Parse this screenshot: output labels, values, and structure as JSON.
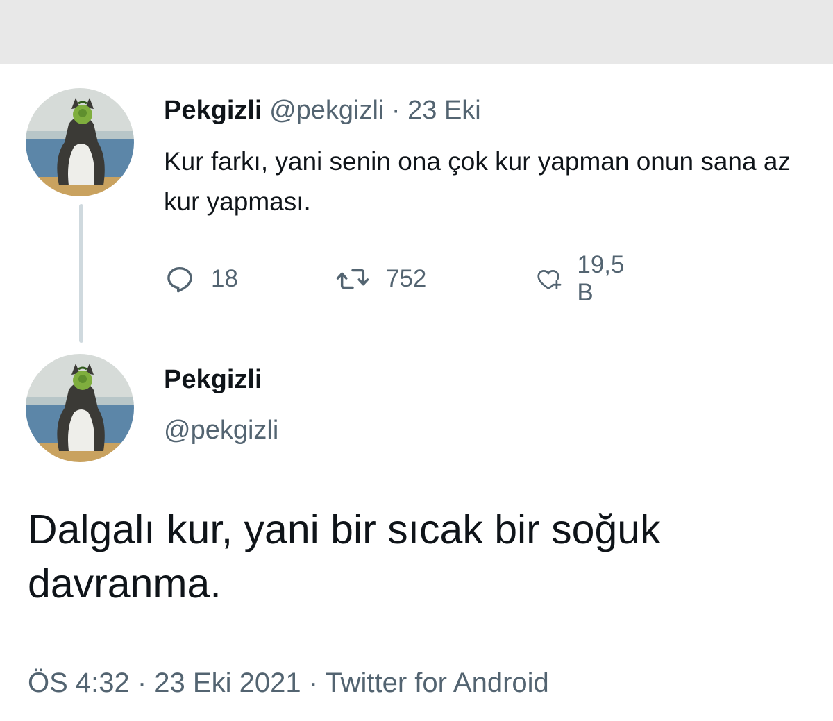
{
  "colors": {
    "text": "#0f1419",
    "secondary": "#536471",
    "thread_line": "#cfd9de",
    "top_bar": "#e8e8e8"
  },
  "tweet1": {
    "display_name": "Pekgizli",
    "meta": "@pekgizli · 23 Eki",
    "text": "Kur farkı, yani senin ona çok kur yapman onun sana az kur yapması.",
    "actions": {
      "reply": {
        "icon": "reply-icon",
        "count": "18"
      },
      "retweet": {
        "icon": "retweet-icon",
        "count": "752"
      },
      "like": {
        "icon": "heart-plus-icon",
        "count": "19,5 B"
      }
    }
  },
  "tweet2": {
    "display_name": "Pekgizli",
    "handle": "@pekgizli",
    "text": "Dalgalı kur, yani bir sıcak bir soğuk davranma.",
    "meta": "ÖS 4:32 · 23 Eki 2021 · Twitter for Android"
  },
  "avatar": {
    "icon": "cat-avatar"
  }
}
